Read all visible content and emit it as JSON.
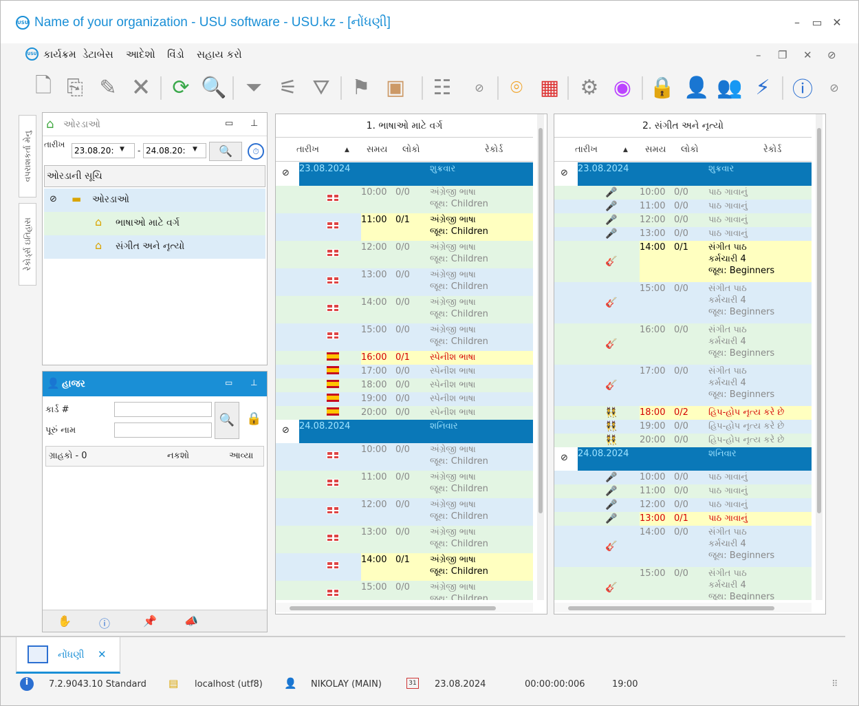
{
  "window": {
    "title": "Name of your organization - USU software - USU.kz - [નોંધણી]",
    "logo": "USU"
  },
  "menu": {
    "items": [
      "કાર્યક્રમ",
      "ડેટાબેસ",
      "આદેશો",
      "વિંડો",
      "સહાય કરો"
    ]
  },
  "vertical_tabs": [
    "વપરાશકર્તા મેનુ",
    "રેકોર્ડ્સ ઇતિહાસ"
  ],
  "rooms_panel": {
    "title": "ઓરડાઓ",
    "date_label": "તારીખ",
    "date_from": "23.08.20:",
    "date_to": "24.08.20:",
    "list_header": "ઓરડાની સૂચિ",
    "tree_root": "ઓરડાઓ",
    "tree_children": [
      "ભાષાઓ માટે વર્ગ",
      "સંગીત અને નૃત્યો"
    ]
  },
  "attendance_panel": {
    "title": "હાજર",
    "card_label": "કાર્ડ #",
    "name_label": "પૂરું નામ",
    "columns": [
      "ગ્રાહકો - 0",
      "નકશો",
      "આવ્યા"
    ]
  },
  "grid_columns": {
    "date": "તારીખ",
    "time": "સમય",
    "people": "લોકો",
    "record": "રેકોર્ડ"
  },
  "schedule1": {
    "title": "1. ભાષાઓ માટે વર્ગ",
    "days": [
      {
        "date": "23.08.2024",
        "weekday": "શુક્રવાર",
        "rows": [
          {
            "time": "10:00",
            "people": "0/0",
            "flag": "uk",
            "lines": [
              "અંગ્રેજી ભાષા",
              "જૂથ: Children"
            ],
            "hl": false
          },
          {
            "time": "11:00",
            "people": "0/1",
            "flag": "uk",
            "lines": [
              "અંગ્રેજી ભાષા",
              "જૂથ: Children"
            ],
            "hl": true
          },
          {
            "time": "12:00",
            "people": "0/0",
            "flag": "uk",
            "lines": [
              "અંગ્રેજી ભાષા",
              "જૂથ: Children"
            ],
            "hl": false
          },
          {
            "time": "13:00",
            "people": "0/0",
            "flag": "uk",
            "lines": [
              "અંગ્રેજી ભાષા",
              "જૂથ: Children"
            ],
            "hl": false
          },
          {
            "time": "14:00",
            "people": "0/0",
            "flag": "uk",
            "lines": [
              "અંગ્રેજી ભાષા",
              "જૂથ: Children"
            ],
            "hl": false
          },
          {
            "time": "15:00",
            "people": "0/0",
            "flag": "uk",
            "lines": [
              "અંગ્રેજી ભાષા",
              "જૂથ: Children"
            ],
            "hl": false
          },
          {
            "time": "16:00",
            "people": "0/1",
            "flag": "es",
            "lines": [
              "સ્પેનીશ ભાષા"
            ],
            "hl": true
          },
          {
            "time": "17:00",
            "people": "0/0",
            "flag": "es",
            "lines": [
              "સ્પેનીશ ભાષા"
            ],
            "hl": false
          },
          {
            "time": "18:00",
            "people": "0/0",
            "flag": "es",
            "lines": [
              "સ્પેનીશ ભાષા"
            ],
            "hl": false
          },
          {
            "time": "19:00",
            "people": "0/0",
            "flag": "es",
            "lines": [
              "સ્પેનીશ ભાષા"
            ],
            "hl": false
          },
          {
            "time": "20:00",
            "people": "0/0",
            "flag": "es",
            "lines": [
              "સ્પેનીશ ભાષા"
            ],
            "hl": false
          }
        ]
      },
      {
        "date": "24.08.2024",
        "weekday": "શનિવાર",
        "rows": [
          {
            "time": "10:00",
            "people": "0/0",
            "flag": "uk",
            "lines": [
              "અંગ્રેજી ભાષા",
              "જૂથ: Children"
            ],
            "hl": false
          },
          {
            "time": "11:00",
            "people": "0/0",
            "flag": "uk",
            "lines": [
              "અંગ્રેજી ભાષા",
              "જૂથ: Children"
            ],
            "hl": false
          },
          {
            "time": "12:00",
            "people": "0/0",
            "flag": "uk",
            "lines": [
              "અંગ્રેજી ભાષા",
              "જૂથ: Children"
            ],
            "hl": false
          },
          {
            "time": "13:00",
            "people": "0/0",
            "flag": "uk",
            "lines": [
              "અંગ્રેજી ભાષા",
              "જૂથ: Children"
            ],
            "hl": false
          },
          {
            "time": "14:00",
            "people": "0/1",
            "flag": "uk",
            "lines": [
              "અંગ્રેજી ભાષા",
              "જૂથ: Children"
            ],
            "hl": true
          },
          {
            "time": "15:00",
            "people": "0/0",
            "flag": "uk",
            "lines": [
              "અંગ્રેજી ભાષા",
              "જૂથ: Children"
            ],
            "hl": false
          }
        ]
      }
    ]
  },
  "schedule2": {
    "title": "2. સંગીત અને નૃત્યો",
    "days": [
      {
        "date": "23.08.2024",
        "weekday": "શુક્રવાર",
        "rows": [
          {
            "time": "10:00",
            "people": "0/0",
            "icon": "mic",
            "lines": [
              "પાઠ ગાવાનું"
            ],
            "hl": false
          },
          {
            "time": "11:00",
            "people": "0/0",
            "icon": "mic",
            "lines": [
              "પાઠ ગાવાનું"
            ],
            "hl": false
          },
          {
            "time": "12:00",
            "people": "0/0",
            "icon": "mic",
            "lines": [
              "પાઠ ગાવાનું"
            ],
            "hl": false
          },
          {
            "time": "13:00",
            "people": "0/0",
            "icon": "mic",
            "lines": [
              "પાઠ ગાવાનું"
            ],
            "hl": false
          },
          {
            "time": "14:00",
            "people": "0/1",
            "icon": "guitar",
            "lines": [
              "સંગીત પાઠ",
              "કર્મચારી 4",
              "જૂથ: Beginners"
            ],
            "hl": true
          },
          {
            "time": "15:00",
            "people": "0/0",
            "icon": "guitar",
            "lines": [
              "સંગીત પાઠ",
              "કર્મચારી 4",
              "જૂથ: Beginners"
            ],
            "hl": false
          },
          {
            "time": "16:00",
            "people": "0/0",
            "icon": "guitar",
            "lines": [
              "સંગીત પાઠ",
              "કર્મચારી 4",
              "જૂથ: Beginners"
            ],
            "hl": false
          },
          {
            "time": "17:00",
            "people": "0/0",
            "icon": "guitar",
            "lines": [
              "સંગીત પાઠ",
              "કર્મચારી 4",
              "જૂથ: Beginners"
            ],
            "hl": false
          },
          {
            "time": "18:00",
            "people": "0/2",
            "icon": "dance",
            "lines": [
              "હિપ-હોપ નૃત્ય કરે છે"
            ],
            "hl": true
          },
          {
            "time": "19:00",
            "people": "0/0",
            "icon": "dance",
            "lines": [
              "હિપ-હોપ નૃત્ય કરે છે"
            ],
            "hl": false
          },
          {
            "time": "20:00",
            "people": "0/0",
            "icon": "dance",
            "lines": [
              "હિપ-હોપ નૃત્ય કરે છે"
            ],
            "hl": false
          }
        ]
      },
      {
        "date": "24.08.2024",
        "weekday": "શનિવાર",
        "rows": [
          {
            "time": "10:00",
            "people": "0/0",
            "icon": "mic",
            "lines": [
              "પાઠ ગાવાનું"
            ],
            "hl": false
          },
          {
            "time": "11:00",
            "people": "0/0",
            "icon": "mic",
            "lines": [
              "પાઠ ગાવાનું"
            ],
            "hl": false
          },
          {
            "time": "12:00",
            "people": "0/0",
            "icon": "mic",
            "lines": [
              "પાઠ ગાવાનું"
            ],
            "hl": false
          },
          {
            "time": "13:00",
            "people": "0/1",
            "icon": "mic",
            "lines": [
              "પાઠ ગાવાનું"
            ],
            "hl": true
          },
          {
            "time": "14:00",
            "people": "0/0",
            "icon": "guitar",
            "lines": [
              "સંગીત પાઠ",
              "કર્મચારી 4",
              "જૂથ: Beginners"
            ],
            "hl": false
          },
          {
            "time": "15:00",
            "people": "0/0",
            "icon": "guitar",
            "lines": [
              "સંગીત પાઠ",
              "કર્મચારી 4",
              "જૂથ: Beginners"
            ],
            "hl": false
          }
        ]
      }
    ]
  },
  "bottom_tab": {
    "label": "નોંધણી"
  },
  "status": {
    "version": "7.2.9043.10 Standard",
    "db": "localhost (utf8)",
    "user": "NIKOLAY (MAIN)",
    "date": "23.08.2024",
    "timer": "00:00:00:006",
    "time": "19:00",
    "cal_day": "31"
  },
  "colors": {
    "accent": "#1a8fd6",
    "day_bar": "#0a78b8",
    "row_green": "#e3f5e3",
    "row_blue": "#dcecf8",
    "highlight": "#ffffc0",
    "red_text": "#d40000"
  }
}
